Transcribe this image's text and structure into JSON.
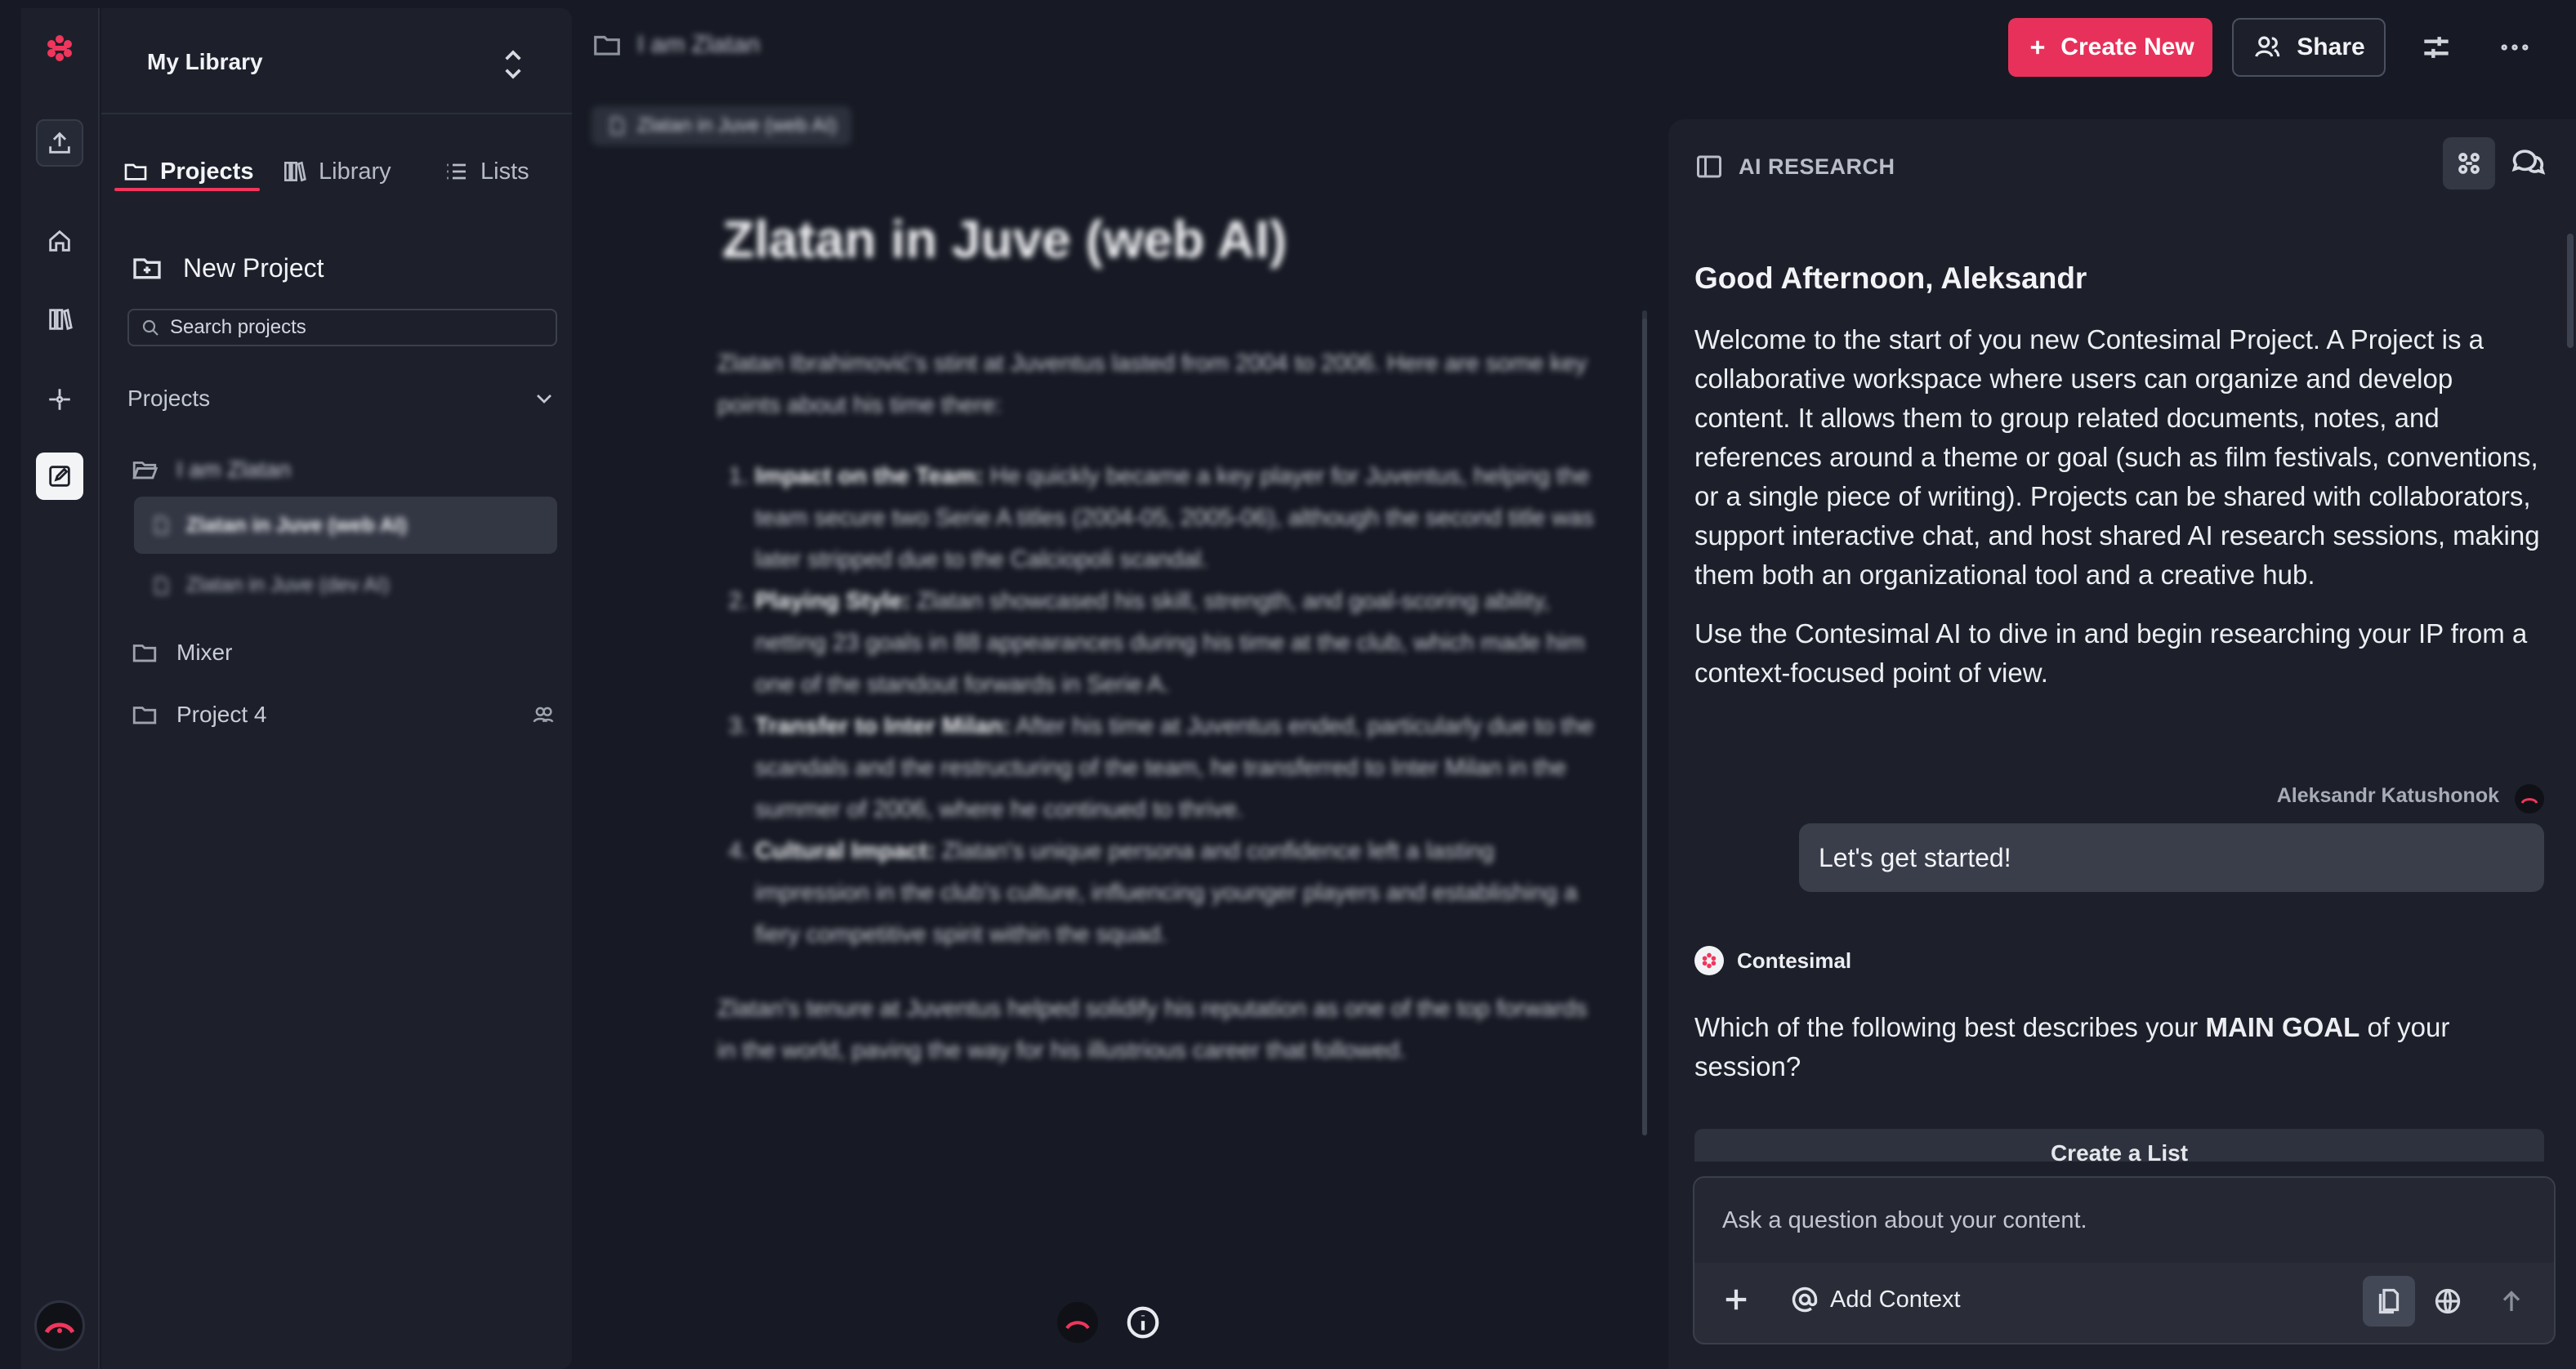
{
  "colors": {
    "accent": "#e8315a",
    "background": "#171a24",
    "panel": "#1d202b"
  },
  "sidebar": {
    "library_title": "My Library",
    "tabs": [
      {
        "label": "Projects",
        "icon": "folder-icon",
        "active": true
      },
      {
        "label": "Library",
        "icon": "books-icon"
      },
      {
        "label": "Lists",
        "icon": "list-icon"
      }
    ],
    "new_project_label": "New Project",
    "search_placeholder": "Search projects",
    "projects_heading": "Projects",
    "tree": {
      "folder_open": "I am Zlatan",
      "doc_active": "Zlatan in Juve (web AI)",
      "doc_other": "Zlatan in Juve (dev AI)",
      "mixer": "Mixer",
      "project4": "Project 4"
    }
  },
  "document": {
    "breadcrumb": "I am Zlatan",
    "chip": "Zlatan in Juve (web AI)",
    "title": "Zlatan in Juve (web AI)",
    "intro": "Zlatan Ibrahimović's stint at Juventus lasted from 2004 to 2006. Here are some key points about his time there:",
    "points": [
      {
        "head": "Impact on the Team:",
        "text": " He quickly became a key player for Juventus, helping the team secure two Serie A titles (2004-05, 2005-06), although the second title was later stripped due to the Calciopoli scandal."
      },
      {
        "head": "Playing Style:",
        "text": " Zlatan showcased his skill, strength, and goal-scoring ability, netting 23 goals in 88 appearances during his time at the club, which made him one of the standout forwards in Serie A."
      },
      {
        "head": "Transfer to Inter Milan:",
        "text": " After his time at Juventus ended, particularly due to the scandals and the restructuring of the team, he transferred to Inter Milan in the summer of 2006, where he continued to thrive."
      },
      {
        "head": "Cultural Impact:",
        "text": " Zlatan's unique persona and confidence left a lasting impression in the club's culture, influencing younger players and establishing a fiery competitive spirit within the squad."
      }
    ],
    "closing": "Zlatan's tenure at Juventus helped solidify his reputation as one of the top forwards in the world, paving the way for his illustrious career that followed."
  },
  "topbar": {
    "create_new": "Create New",
    "share": "Share"
  },
  "ai_panel": {
    "header": "AI RESEARCH",
    "greeting": "Good Afternoon, Aleksandr",
    "intro_p1": "Welcome to the start of you new Contesimal Project. A Project is a collaborative workspace where users can organize and develop content. It allows them to group related documents, notes, and references around a theme or goal (such as film festivals, conventions, or a single piece of writing). Projects can be shared with collaborators, support interactive chat, and host shared AI research sessions, making them both an organizational tool and a creative hub.",
    "intro_p2": "Use the Contesimal AI to dive in and begin researching your IP from a context-focused point of view.",
    "user_name": "Aleksandr Katushonok",
    "user_message": "Let's get started!",
    "bot_name": "Contesimal",
    "question_pre": "Which of the following best describes your ",
    "question_bold": "MAIN GOAL",
    "question_post": " of your session?",
    "option_partial": "Create a List",
    "composer_placeholder": "Ask a question about your content.",
    "add_context": "Add Context"
  }
}
